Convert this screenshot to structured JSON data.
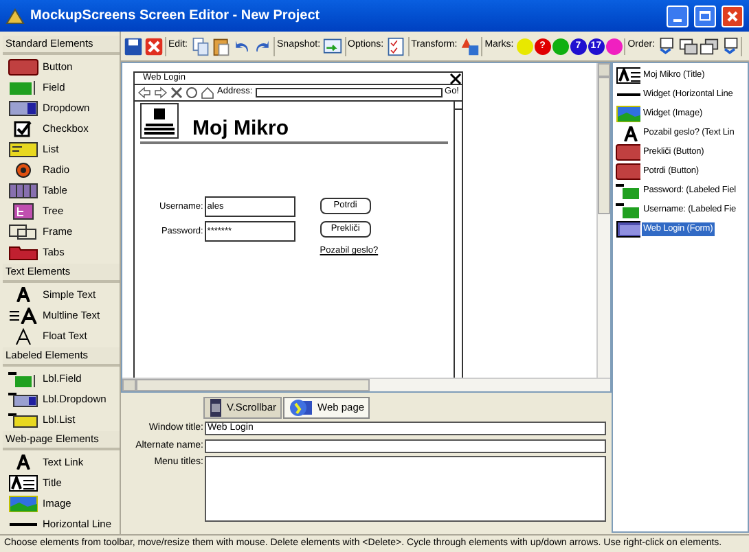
{
  "window": {
    "title": "MockupScreens Screen Editor - New Project"
  },
  "toolbar": {
    "groups": [
      {
        "kind": "file"
      },
      {
        "kind": "edit",
        "label": "Edit:"
      },
      {
        "kind": "snapshot",
        "label": "Snapshot:"
      },
      {
        "kind": "options",
        "label": "Options:"
      },
      {
        "kind": "transform",
        "label": "Transform:"
      },
      {
        "kind": "marks",
        "label": "Marks:"
      },
      {
        "kind": "order",
        "label": "Order:"
      }
    ],
    "marks": [
      {
        "color": "#e8e800"
      },
      {
        "text": "?",
        "color": "#e00000"
      },
      {
        "color": "#10b010"
      },
      {
        "text": "7",
        "color": "#2010d0"
      },
      {
        "text": "17",
        "color": "#2010d0"
      },
      {
        "color": "#f020c0"
      }
    ]
  },
  "palette": [
    {
      "title": "Standard Elements",
      "items": [
        {
          "label": "Button",
          "kind": "button"
        },
        {
          "label": "Field",
          "kind": "field"
        },
        {
          "label": "Dropdown",
          "kind": "dropdown"
        },
        {
          "label": "Checkbox",
          "kind": "checkbox"
        },
        {
          "label": "List",
          "kind": "list"
        },
        {
          "label": "Radio",
          "kind": "radio"
        },
        {
          "label": "Table",
          "kind": "table"
        },
        {
          "label": "Tree",
          "kind": "tree"
        },
        {
          "label": "Frame",
          "kind": "frame"
        },
        {
          "label": "Tabs",
          "kind": "tabs"
        }
      ]
    },
    {
      "title": "Text Elements",
      "items": [
        {
          "label": "Simple Text",
          "kind": "text"
        },
        {
          "label": "Multline Text",
          "kind": "multitext"
        },
        {
          "label": "Float Text",
          "kind": "floattext"
        }
      ]
    },
    {
      "title": "Labeled Elements",
      "items": [
        {
          "label": "Lbl.Field",
          "kind": "lblfield"
        },
        {
          "label": "Lbl.Dropdown",
          "kind": "lbldropdown"
        },
        {
          "label": "Lbl.List",
          "kind": "lbllist"
        }
      ]
    },
    {
      "title": "Web-page Elements",
      "items": [
        {
          "label": "Text Link",
          "kind": "text"
        },
        {
          "label": "Title",
          "kind": "title"
        },
        {
          "label": "Image",
          "kind": "image"
        },
        {
          "label": "Horizontal Line",
          "kind": "hline"
        }
      ]
    }
  ],
  "mockup": {
    "title": "Web Login",
    "address_label": "Address:",
    "go": "Go!",
    "heading": "Moj Mikro",
    "fields": [
      {
        "label": "Username:",
        "value": "ales"
      },
      {
        "label": "Password:",
        "value": "*******"
      }
    ],
    "buttons": [
      "Potrdi",
      "Prekliči"
    ],
    "link": "Pozabil geslo?"
  },
  "properties": {
    "tabs": [
      {
        "label": "V.Scrollbar",
        "kind": "scrollbar",
        "selected": false
      },
      {
        "label": "Web page",
        "kind": "webpage",
        "selected": true
      }
    ],
    "fields": [
      {
        "label": "Window title:",
        "value": "Web Login",
        "kind": "line"
      },
      {
        "label": "Alternate name:",
        "kind": "line"
      },
      {
        "label": "Menu titles:",
        "kind": "area"
      }
    ]
  },
  "elements": [
    {
      "label": "Moj Mikro (Title)",
      "kind": "title",
      "selected": false
    },
    {
      "label": "Widget (Horizontal Line",
      "kind": "hline",
      "selected": false
    },
    {
      "label": "Widget (Image)",
      "kind": "image",
      "selected": false
    },
    {
      "label": "Pozabil geslo? (Text Lin",
      "kind": "text",
      "selected": false
    },
    {
      "label": "Prekliči (Button)",
      "kind": "button",
      "selected": false
    },
    {
      "label": "Potrdi (Button)",
      "kind": "button",
      "selected": false
    },
    {
      "label": "Password: (Labeled Fiel",
      "kind": "lblfield",
      "selected": false
    },
    {
      "label": "Username: (Labeled Fie",
      "kind": "lblfield",
      "selected": false
    },
    {
      "label": "Web Login (Form)",
      "kind": "form",
      "selected": true
    }
  ],
  "status_bar": "Choose elements from toolbar, move/resize them with mouse. Delete elements with <Delete>. Cycle through elements with up/down arrows. Use right-click on elements."
}
